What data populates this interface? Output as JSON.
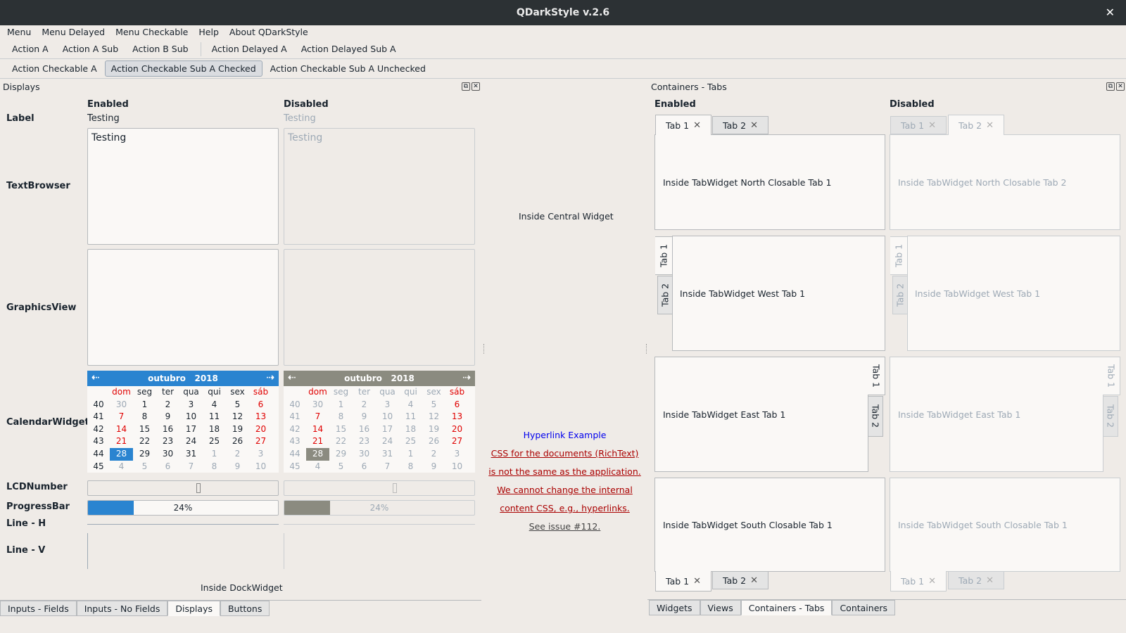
{
  "window": {
    "title": "QDarkStyle v.2.6",
    "close": "✕"
  },
  "menubar": [
    "Menu",
    "Menu Delayed",
    "Menu Checkable",
    "Help",
    "About QDarkStyle"
  ],
  "toolbar1": {
    "a": "Action A",
    "b": "Action A Sub",
    "c": "Action B Sub",
    "d": "Action Delayed A",
    "e": "Action Delayed Sub A"
  },
  "toolbar2": {
    "a": "Action Checkable A",
    "b": "Action Checkable Sub A Checked",
    "c": "Action Checkable Sub A Unchecked"
  },
  "left_dock": {
    "title": "Displays",
    "enabled": "Enabled",
    "disabled": "Disabled",
    "labels": {
      "label": "Label",
      "textbrowser": "TextBrowser",
      "graphicsview": "GraphicsView",
      "calendar": "CalendarWidget",
      "lcd": "LCDNumber",
      "progress": "ProgressBar",
      "lineh": "Line - H",
      "linev": "Line - V"
    },
    "label_text": "Testing",
    "textbrowser_text": "Testing",
    "progress": {
      "value": 24,
      "text": "24%"
    },
    "footer": "Inside DockWidget",
    "tabs": [
      "Inputs - Fields",
      "Inputs - No Fields",
      "Displays",
      "Buttons"
    ],
    "active_tab": "Displays"
  },
  "calendar": {
    "month": "outubro",
    "year": "2018",
    "days": [
      "dom",
      "seg",
      "ter",
      "qua",
      "qui",
      "sex",
      "sáb"
    ],
    "weeks": [
      {
        "wk": "40",
        "d": [
          "30",
          "1",
          "2",
          "3",
          "4",
          "5",
          "6"
        ]
      },
      {
        "wk": "41",
        "d": [
          "7",
          "8",
          "9",
          "10",
          "11",
          "12",
          "13"
        ]
      },
      {
        "wk": "42",
        "d": [
          "14",
          "15",
          "16",
          "17",
          "18",
          "19",
          "20"
        ]
      },
      {
        "wk": "43",
        "d": [
          "21",
          "22",
          "23",
          "24",
          "25",
          "26",
          "27"
        ]
      },
      {
        "wk": "44",
        "d": [
          "28",
          "29",
          "30",
          "31",
          "1",
          "2",
          "3"
        ]
      },
      {
        "wk": "45",
        "d": [
          "4",
          "5",
          "6",
          "7",
          "8",
          "9",
          "10"
        ]
      }
    ],
    "selected": "28",
    "enabled_color": "#2A84D0",
    "disabled_color": "#8B8B80"
  },
  "central": {
    "text": "Inside Central Widget",
    "hyperlink": "Hyperlink Example",
    "rich": [
      "CSS for the documents (RichText)",
      "is not the same as the application.",
      "We cannot change the internal",
      "content CSS, e.g., hyperlinks."
    ],
    "issue": "See issue #112."
  },
  "right_dock": {
    "title": "Containers - Tabs",
    "enabled": "Enabled",
    "disabled": "Disabled",
    "tab1": "Tab 1",
    "tab2": "Tab 2",
    "north_en": "Inside TabWidget North Closable Tab 1",
    "north_dis": "Inside TabWidget North Closable Tab 2",
    "west_en": "Inside TabWidget West Tab 1",
    "west_dis": "Inside TabWidget West Tab 1",
    "east_en": "Inside TabWidget East Tab 1",
    "east_dis": "Inside TabWidget East Tab 1",
    "south_en": "Inside TabWidget South Closable Tab 1",
    "south_dis": "Inside TabWidget South Closable Tab 1",
    "tabs": [
      "Widgets",
      "Views",
      "Containers - Tabs",
      "Containers"
    ],
    "active_tab": "Containers - Tabs"
  }
}
